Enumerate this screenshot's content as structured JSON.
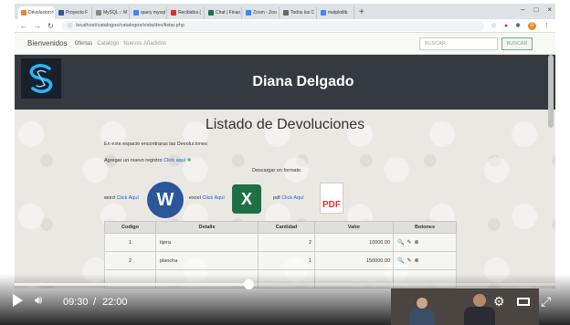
{
  "browser": {
    "tabs": [
      {
        "label": "Devolucion",
        "color": "#e8872a",
        "active": true
      },
      {
        "label": "Proyecto F",
        "color": "#2b579a"
      },
      {
        "label": "MySQL :: M",
        "color": "#888"
      },
      {
        "label": "query mysql",
        "color": "#4285f4"
      },
      {
        "label": "Recibidos (",
        "color": "#d93025"
      },
      {
        "label": "Chat | Finan",
        "color": "#1e7145"
      },
      {
        "label": "Zoom - Zoo",
        "color": "#2d8cff"
      },
      {
        "label": "Todos los C",
        "color": "#666"
      },
      {
        "label": "matplotlib",
        "color": "#4285f4"
      }
    ],
    "new_tab": "+",
    "url": "localhost/catalogos/catalogos/vista/dev/listar.php"
  },
  "site": {
    "brand": "Bienvenidos",
    "nav": [
      "Ofertas",
      "Catalogo",
      "Nuevos Añadidos"
    ],
    "search_placeholder": "BUSCAR",
    "search_button": "BUSCAR",
    "owner": "Diana Delgado",
    "heading": "Listado de Devoluciones",
    "intro": "En este espacio encontraras las Devoluciones",
    "add_prefix": "Agregar un nuevo registro",
    "add_link": "Click aquí",
    "download_title": "Descargar en formato",
    "downloads": {
      "word_label": "word",
      "excel_label": "excel",
      "pdf_label": "pdf",
      "link": "Click Aquí"
    },
    "table": {
      "headers": [
        "Codigo",
        "Detalle",
        "Cantidad",
        "Valor",
        "Botones"
      ],
      "rows": [
        {
          "codigo": "1",
          "detalle": "tijera",
          "cantidad": "2",
          "valor": "10000.00"
        },
        {
          "codigo": "2",
          "detalle": "plancha",
          "cantidad": "1",
          "valor": "150000.00"
        }
      ]
    }
  },
  "player": {
    "current_time": "09:30",
    "separator": "/",
    "duration": "22:00",
    "progress": 0.432
  }
}
